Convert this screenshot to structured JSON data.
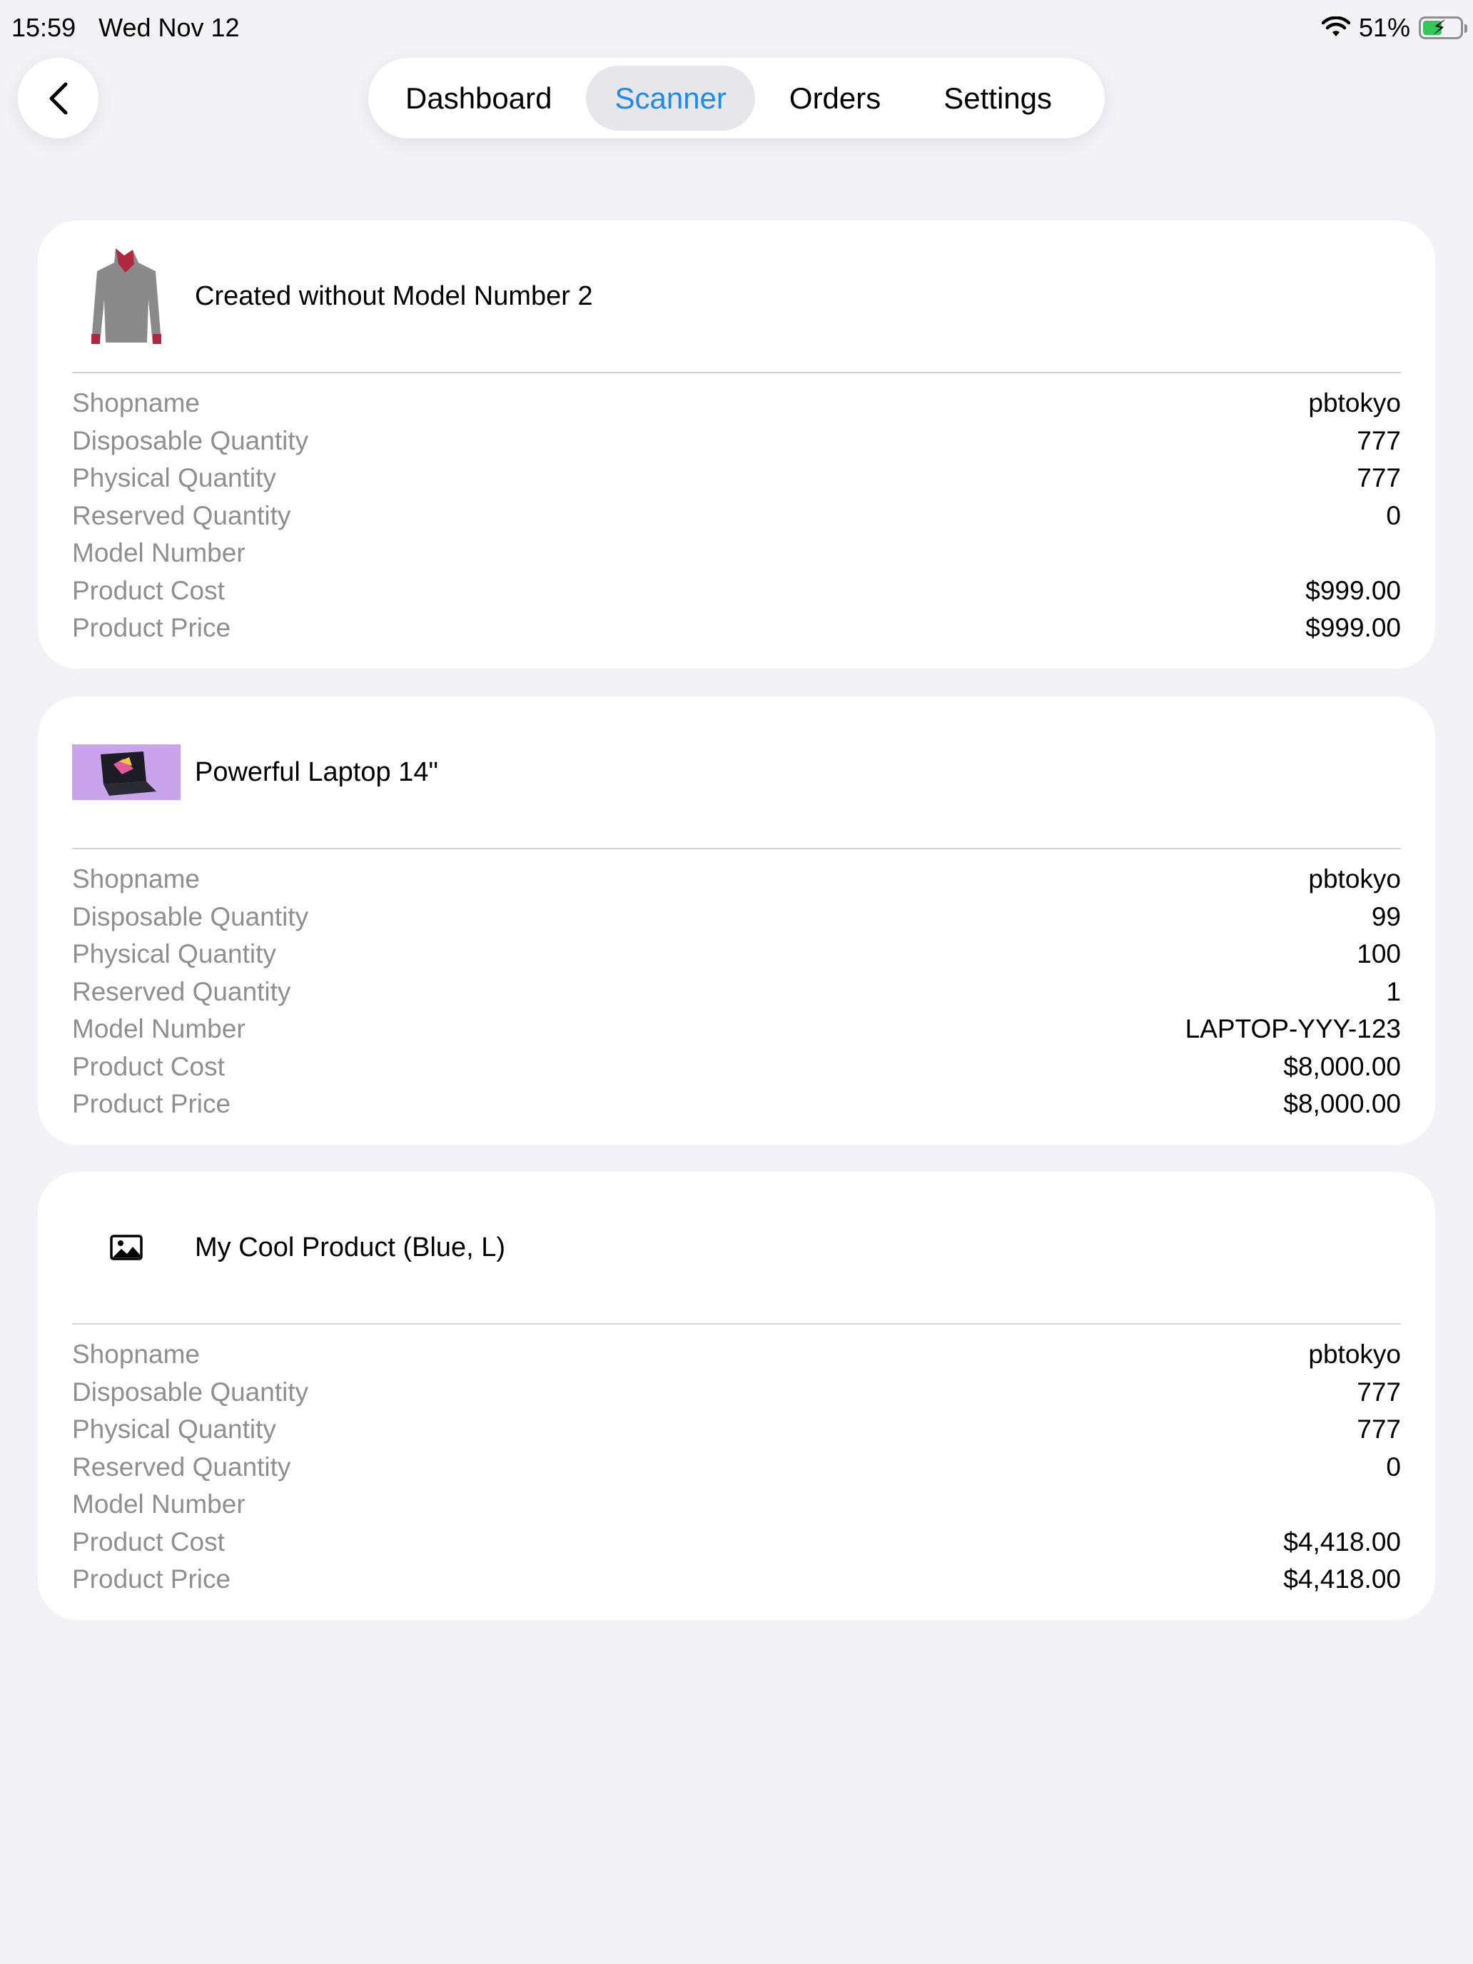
{
  "status": {
    "time": "15:59",
    "date": "Wed Nov 12",
    "battery": "51%",
    "battery_level": 0.51
  },
  "nav": {
    "tabs": [
      {
        "label": "Dashboard",
        "active": false
      },
      {
        "label": "Scanner",
        "active": true
      },
      {
        "label": "Orders",
        "active": false
      },
      {
        "label": "Settings",
        "active": false
      }
    ]
  },
  "row_labels": [
    "Shopname",
    "Disposable Quantity",
    "Physical Quantity",
    "Reserved Quantity",
    "Model Number",
    "Product Cost",
    "Product Price"
  ],
  "products": [
    {
      "title": "Created without Model Number 2",
      "image": "sweater",
      "values": [
        "pbtokyo",
        "777",
        "777",
        "0",
        "",
        "$999.00",
        "$999.00"
      ]
    },
    {
      "title": "Powerful Laptop 14\"",
      "image": "laptop",
      "values": [
        "pbtokyo",
        "99",
        "100",
        "1",
        "LAPTOP-YYY-123",
        "$8,000.00",
        "$8,000.00"
      ]
    },
    {
      "title": "My Cool Product (Blue, L)",
      "image": "photo-placeholder-icon",
      "values": [
        "pbtokyo",
        "777",
        "777",
        "0",
        "",
        "$4,418.00",
        "$4,418.00"
      ]
    }
  ],
  "colors": {
    "accent": "#1a8cf0",
    "background": "#f2f2f7",
    "label": "#8e8e93",
    "battery": "#34c759"
  }
}
